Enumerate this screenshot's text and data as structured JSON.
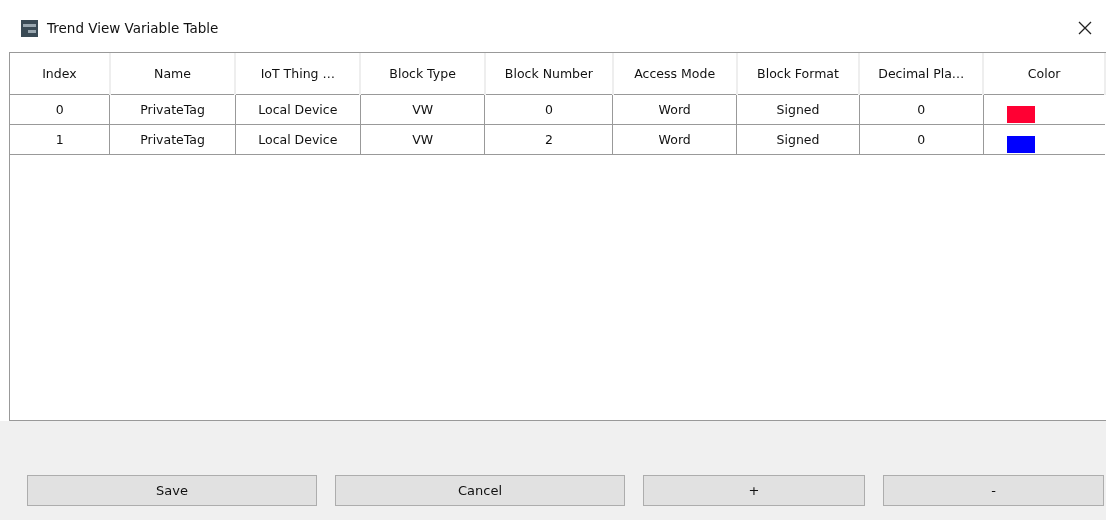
{
  "window": {
    "title": "Trend View Variable Table"
  },
  "table": {
    "columns": [
      "Index",
      "Name",
      "IoT Thing …",
      "Block Type",
      "Block Number",
      "Access Mode",
      "Block Format",
      "Decimal Pla…",
      "Color"
    ],
    "rows": [
      {
        "cells": [
          "0",
          "PrivateTag",
          "Local Device",
          "VW",
          "0",
          "Word",
          "Signed",
          "0"
        ],
        "color": "#ff0033"
      },
      {
        "cells": [
          "1",
          "PrivateTag",
          "Local Device",
          "VW",
          "2",
          "Word",
          "Signed",
          "0"
        ],
        "color": "#0000ff"
      }
    ]
  },
  "buttons": [
    {
      "label": "Save",
      "kind": "save"
    },
    {
      "label": "Cancel",
      "kind": "cancel"
    },
    {
      "label": "+",
      "kind": "add"
    },
    {
      "label": "-",
      "kind": "remove"
    }
  ]
}
